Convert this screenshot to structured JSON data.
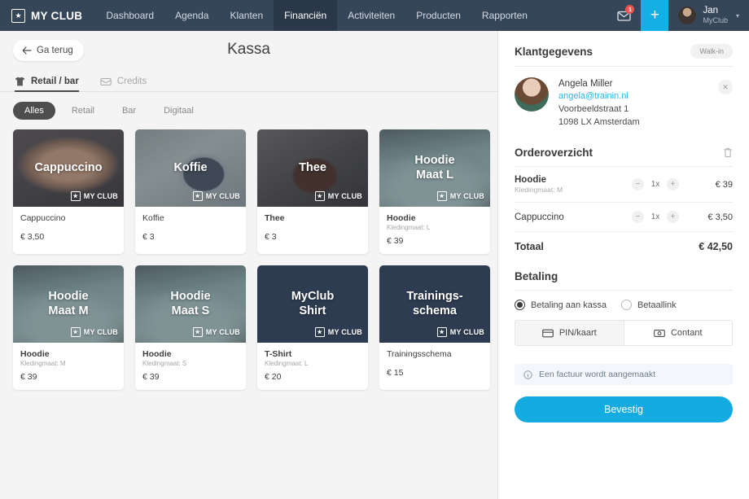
{
  "topnav": {
    "brand": "MY CLUB",
    "brand_icon": "star-icon",
    "links": [
      {
        "label": "Dashboard",
        "active": false
      },
      {
        "label": "Agenda",
        "active": false
      },
      {
        "label": "Klanten",
        "active": false
      },
      {
        "label": "Financiën",
        "active": true
      },
      {
        "label": "Activiteiten",
        "active": false
      },
      {
        "label": "Producten",
        "active": false
      },
      {
        "label": "Rapporten",
        "active": false
      }
    ],
    "mail_icon": "envelope-icon",
    "mail_badge": "1",
    "plus_label": "+",
    "user_name": "Jan",
    "user_org": "MyClub",
    "caret": "▾",
    "accent": "#14b0e5",
    "bar_color": "#364659"
  },
  "left": {
    "back_label": "Ga terug",
    "back_icon": "arrow-left-icon",
    "title": "Kassa",
    "tabs": [
      {
        "label": "Retail / bar",
        "icon": "tshirt-icon",
        "active": true
      },
      {
        "label": "Credits",
        "icon": "ticket-icon",
        "active": false
      }
    ],
    "filters": [
      {
        "label": "Alles",
        "active": true
      },
      {
        "label": "Retail",
        "active": false
      },
      {
        "label": "Bar",
        "active": false
      },
      {
        "label": "Digitaal",
        "active": false
      }
    ],
    "badge_text": "MY CLUB",
    "products": [
      {
        "overlay": "Cappuccino",
        "name": "Cappuccino",
        "sub": "",
        "price": "€ 3,50",
        "style": "img-cappuccino",
        "photo": true,
        "bold": false
      },
      {
        "overlay": "Koffie",
        "name": "Koffie",
        "sub": "",
        "price": "€ 3",
        "style": "img-koffie",
        "photo": true,
        "bold": false
      },
      {
        "overlay": "Thee",
        "name": "Thee",
        "sub": "",
        "price": "€ 3",
        "style": "img-thee",
        "photo": true,
        "bold": true
      },
      {
        "overlay": "Hoodie\nMaat L",
        "name": "Hoodie",
        "sub": "Kledingmaat: L",
        "price": "€ 39",
        "style": "img-hoodie",
        "photo": true,
        "bold": true
      },
      {
        "overlay": "Hoodie\nMaat M",
        "name": "Hoodie",
        "sub": "Kledingmaat: M",
        "price": "€ 39",
        "style": "img-hoodie",
        "photo": true,
        "bold": true
      },
      {
        "overlay": "Hoodie\nMaat S",
        "name": "Hoodie",
        "sub": "Kledingmaat: S",
        "price": "€ 39",
        "style": "img-hoodie",
        "photo": true,
        "bold": true
      },
      {
        "overlay": "MyClub\nShirt",
        "name": "T-Shirt",
        "sub": "Kledingmaat: L",
        "price": "€ 20",
        "style": "img-solid",
        "photo": false,
        "bold": true
      },
      {
        "overlay": "Trainings-\nschema",
        "name": "Trainingsschema",
        "sub": "",
        "price": "€ 15",
        "style": "img-solid",
        "photo": false,
        "bold": false
      }
    ]
  },
  "customer": {
    "section_title": "Klantgegevens",
    "badge": "Walk-in",
    "name": "Angela Miller",
    "email": "angela@trainin.nl",
    "street": "Voorbeeldstraat 1",
    "city": "1098 LX Amsterdam",
    "close_icon": "close-circle-icon"
  },
  "order": {
    "section_title": "Orderoverzicht",
    "trash_icon": "trash-icon",
    "minus": "−",
    "plus": "+",
    "lines": [
      {
        "name": "Hoodie",
        "sub": "Kledingmaat: M",
        "qty": "1x",
        "price": "€ 39",
        "bold": true
      },
      {
        "name": "Cappuccino",
        "sub": "",
        "qty": "1x",
        "price": "€ 3,50",
        "bold": false
      }
    ],
    "total_label": "Totaal",
    "total_value": "€ 42,50"
  },
  "payment": {
    "section_title": "Betaling",
    "options": [
      {
        "label": "Betaling aan kassa",
        "selected": true
      },
      {
        "label": "Betaallink",
        "selected": false
      }
    ],
    "methods": [
      {
        "label": "PIN/kaart",
        "icon": "card-icon",
        "selected": true
      },
      {
        "label": "Contant",
        "icon": "cash-icon",
        "selected": false
      }
    ],
    "notice": "Een factuur wordt aangemaakt",
    "notice_icon": "info-icon",
    "confirm_label": "Bevestig",
    "confirm_color": "#14ace0"
  }
}
